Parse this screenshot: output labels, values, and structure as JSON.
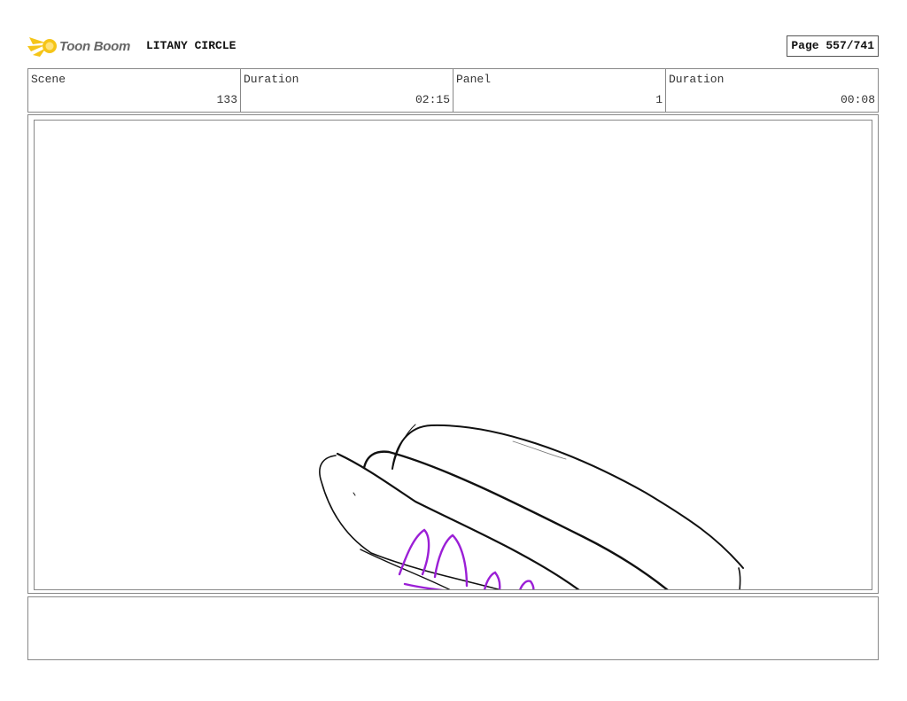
{
  "header": {
    "logo_text": "Toon Boom",
    "project_title": "LITANY CIRCLE",
    "page_label": "Page 557/741"
  },
  "info": {
    "scene_label": "Scene",
    "scene_value": "133",
    "scene_duration_label": "Duration",
    "scene_duration_value": "02:15",
    "panel_label": "Panel",
    "panel_value": "1",
    "panel_duration_label": "Duration",
    "panel_duration_value": "00:08"
  },
  "notes": {
    "text": ""
  },
  "colors": {
    "logo_accent": "#f5c518",
    "sketch_line": "#111111",
    "sketch_color": "#9b1fd6"
  }
}
